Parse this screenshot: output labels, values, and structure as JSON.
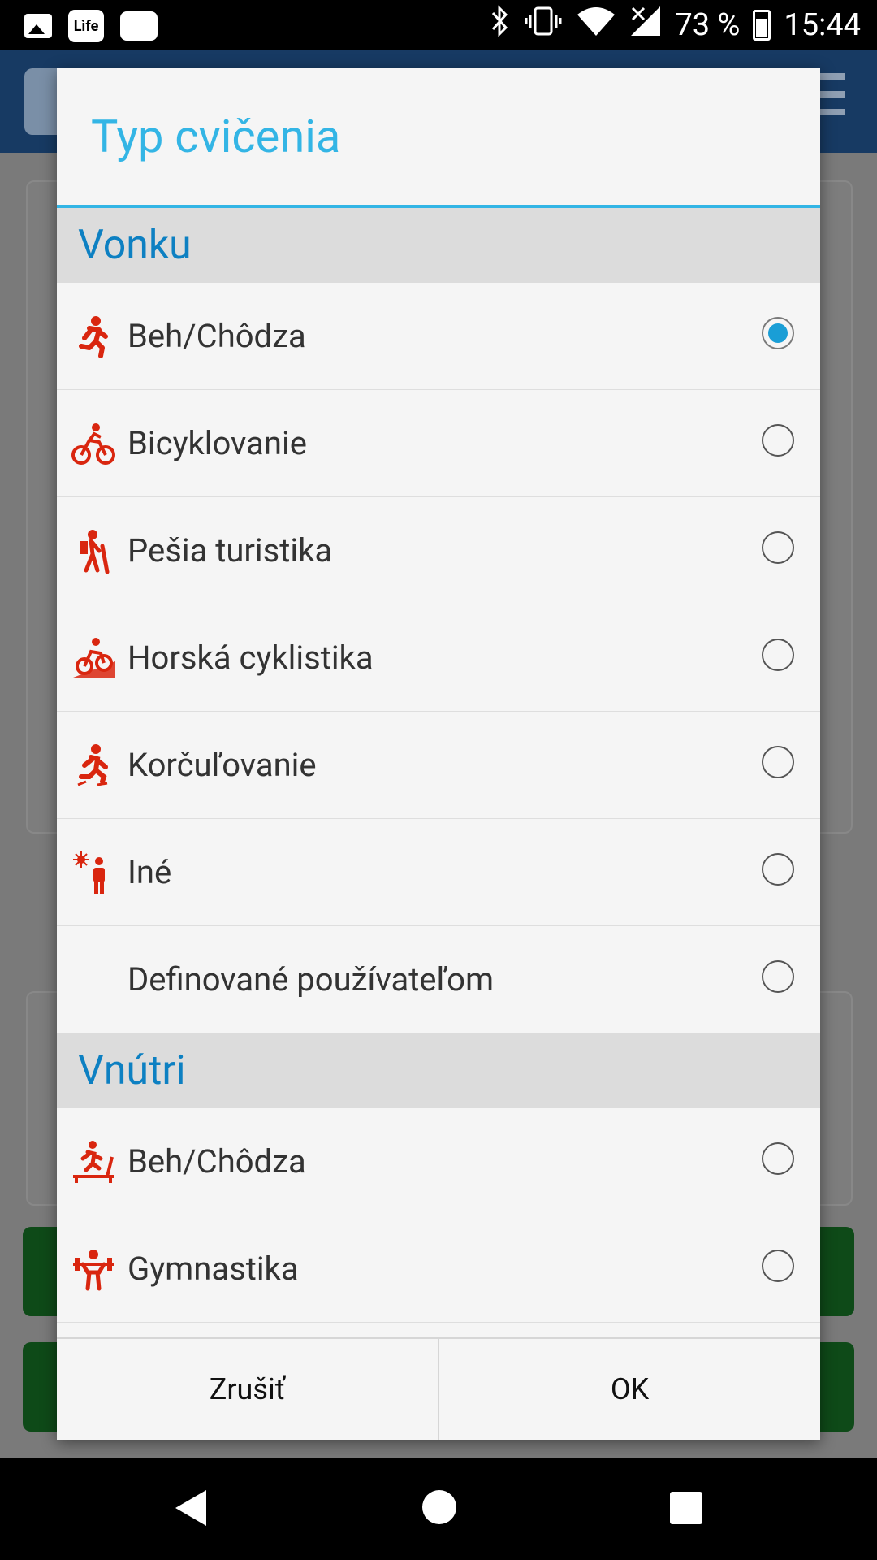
{
  "status_bar": {
    "battery": "73 %",
    "time": "15:44",
    "left_icons": [
      "image-icon",
      "life-app-icon",
      "card-icon"
    ],
    "life_label": "Lìfe",
    "right_icons": [
      "bluetooth-icon",
      "vibrate-icon",
      "wifi-icon",
      "no-signal-icon",
      "battery-icon"
    ]
  },
  "dialog": {
    "title": "Typ cvičenia",
    "sections": [
      {
        "header": "Vonku",
        "items": [
          {
            "label": "Beh/Chôdza",
            "icon": "running-icon",
            "checked": true
          },
          {
            "label": "Bicyklovanie",
            "icon": "cycling-icon",
            "checked": false
          },
          {
            "label": "Pešia turistika",
            "icon": "hiking-icon",
            "checked": false
          },
          {
            "label": "Horská cyklistika",
            "icon": "mountain-bike-icon",
            "checked": false
          },
          {
            "label": "Korčuľovanie",
            "icon": "skating-icon",
            "checked": false
          },
          {
            "label": "Iné",
            "icon": "outdoor-other-icon",
            "checked": false
          },
          {
            "label": "Definované používateľom",
            "icon": "",
            "checked": false
          }
        ]
      },
      {
        "header": "Vnútri",
        "items": [
          {
            "label": "Beh/Chôdza",
            "icon": "treadmill-icon",
            "checked": false
          },
          {
            "label": "Gymnastika",
            "icon": "weightlifting-icon",
            "checked": false
          }
        ]
      }
    ],
    "cancel_label": "Zrušiť",
    "ok_label": "OK"
  },
  "colors": {
    "title": "#33b5e5",
    "section_header": "#0d80c2",
    "icon": "#d9260f",
    "radio_checked": "#1a9ed6"
  },
  "nav_bar": [
    "back-icon",
    "home-icon",
    "recents-icon"
  ]
}
